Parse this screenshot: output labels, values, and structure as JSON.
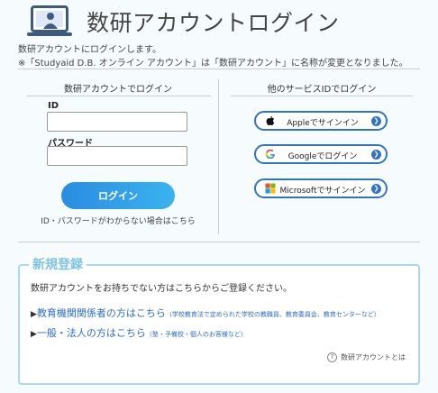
{
  "header": {
    "title": "数研アカウントログイン"
  },
  "intro": {
    "line1": "数研アカウントにログインします。",
    "line2": "※「Studyaid D.B. オンライン アカウント」は「数研アカウント」に名称が変更となりました。"
  },
  "login": {
    "heading": "数研アカウントでログイン",
    "id_label": "ID",
    "id_value": "",
    "password_label": "パスワード",
    "password_value": "",
    "submit_label": "ログイン",
    "forgot_link": "ID・パスワードがわからない場合はこちら"
  },
  "social": {
    "heading": "他のサービスIDでログイン",
    "buttons": [
      {
        "label": "Appleでサインイン",
        "icon": "apple-icon"
      },
      {
        "label": "Googleでログイン",
        "icon": "google-icon"
      },
      {
        "label": "Microsoftでサインイン",
        "icon": "microsoft-icon"
      }
    ]
  },
  "register": {
    "title": "新規登録",
    "lead": "数研アカウントをお持ちでない方はこちらからご登録ください。",
    "links": [
      {
        "arrow": "▶",
        "label": "教育機関関係者の方はこちら",
        "note": "（学校教育法で定められた学校の教職員、教育委員会、教育センターなど）"
      },
      {
        "arrow": "▶",
        "label": "一般・法人の方はこちら",
        "note": "（塾・予備校・個人のお客様など）"
      }
    ],
    "about_label": "数研アカウントとは"
  }
}
